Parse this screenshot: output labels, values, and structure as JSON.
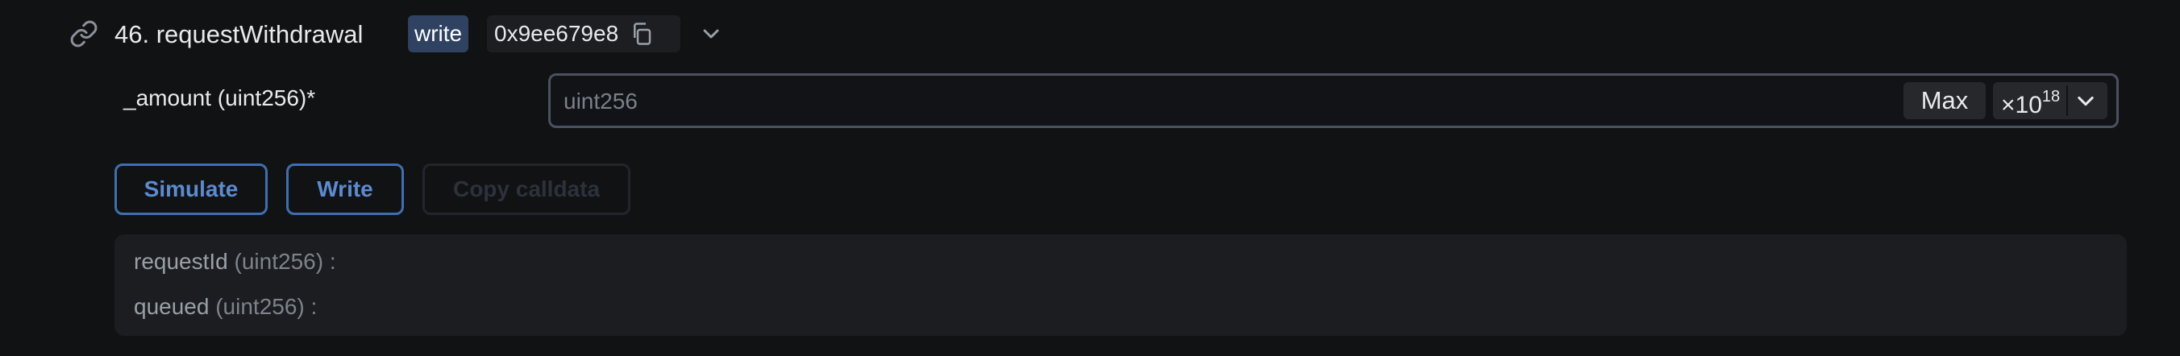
{
  "method": {
    "title": "46. requestWithdrawal",
    "badge": "write",
    "selector": "0x9ee679e8"
  },
  "icons": {
    "link": "link-icon",
    "copy": "copy-icon",
    "expand": "chevron-down-icon"
  },
  "input": {
    "label": "_amount (uint256)*",
    "placeholder": "uint256",
    "value": "",
    "max_label": "Max",
    "unit_base": "×10",
    "unit_exp": "18"
  },
  "actions": {
    "simulate_label": "Simulate",
    "write_label": "Write",
    "calldata_label": "Copy calldata"
  },
  "outputs": [
    {
      "name": "requestId",
      "type": "(uint256)",
      "sep": ":"
    },
    {
      "name": "queued",
      "type": "(uint256)",
      "sep": ":"
    }
  ],
  "colors": {
    "background": "#111214",
    "badge": "#2f4262",
    "accent": "#3f6fb0",
    "panel": "#1c1d20"
  }
}
